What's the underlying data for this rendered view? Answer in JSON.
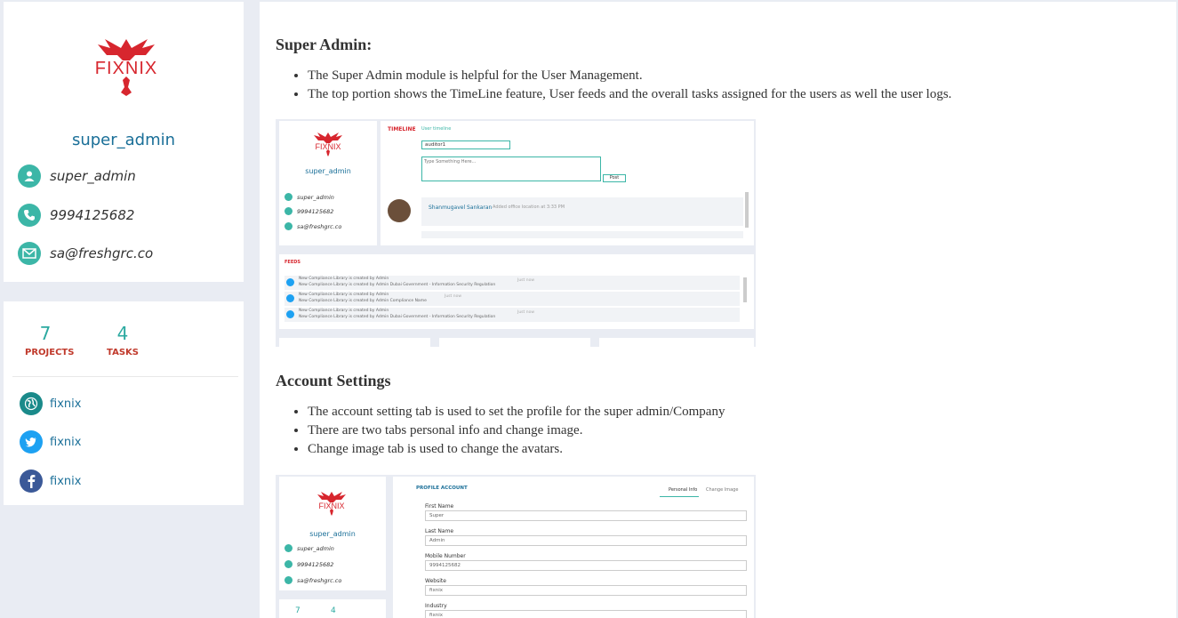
{
  "profile": {
    "logo_text": "FIXNIX",
    "name": "super_admin",
    "username": "super_admin",
    "phone": "9994125682",
    "email": "sa@freshgrc.co"
  },
  "stats": {
    "projects_count": "7",
    "projects_label": "PROJECTS",
    "tasks_count": "4",
    "tasks_label": "TASKS"
  },
  "social": [
    {
      "icon": "globe-icon",
      "label": "fixnix",
      "color": "#1a8a8a"
    },
    {
      "icon": "twitter-icon",
      "label": "fixnix",
      "color": "#1da1f2"
    },
    {
      "icon": "facebook-icon",
      "label": "fixnix",
      "color": "#3b5998"
    }
  ],
  "content": {
    "section1_title": "Super Admin:",
    "section1_bullets": [
      "The Super Admin module is helpful for the User Management.",
      "The top portion shows the TimeLine feature, User feeds and the overall tasks assigned for the users as well the user logs."
    ],
    "section2_title": "Account Settings",
    "section2_bullets": [
      "The account setting tab is used to set the profile for the super admin/Company",
      "There are two tabs personal info and change image.",
      "Change image tab is used to change the avatars."
    ]
  },
  "shot1": {
    "logo_text": "FIXNIX",
    "name": "super_admin",
    "username": "super_admin",
    "phone": "9994125682",
    "email": "sa@freshgrc.co",
    "timeline_title": "TIMELINE",
    "timeline_sub": "User timeline",
    "select_value": "auditor1",
    "textarea_placeholder": "Type Something Here...",
    "post_button": "Post",
    "post_author": "Shanmugavel Sankaran",
    "post_text": "Added office location at 3:33 PM",
    "feeds_title": "FEEDS",
    "feeds": [
      {
        "line1": "New Compliance Library is created by Admin",
        "line2": "New Compliance Library is created by Admin Dubai Government - Information Security Regulation",
        "time": "Just now"
      },
      {
        "line1": "New Compliance Library is created by Admin",
        "line2": "New Compliance Library is created by Admin Compliance Name",
        "time": "Just now"
      },
      {
        "line1": "New Compliance Library is created by Admin",
        "line2": "New Compliance Library is created by Admin Dubai Government - Information Security Regulation",
        "time": "Just now"
      }
    ]
  },
  "shot2": {
    "logo_text": "FIXNIX",
    "name": "super_admin",
    "username": "super_admin",
    "phone": "9994125682",
    "email": "sa@freshgrc.co",
    "projects_count": "7",
    "tasks_count": "4",
    "header": "PROFILE ACCOUNT",
    "tab_personal": "Personal Info",
    "tab_change": "Change Image",
    "fields": [
      {
        "label": "First Name",
        "value": "Super"
      },
      {
        "label": "Last Name",
        "value": "Admin"
      },
      {
        "label": "Mobile Number",
        "value": "9994125682"
      },
      {
        "label": "Website",
        "value": "fixnix"
      },
      {
        "label": "Industry",
        "value": "fixnix"
      }
    ]
  }
}
